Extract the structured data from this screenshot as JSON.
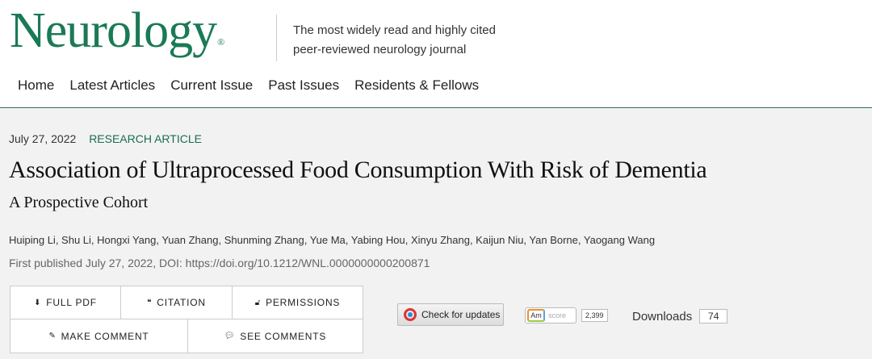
{
  "brand": {
    "name": "Neurology",
    "reg": "®",
    "tagline_line1": "The most widely read and highly cited",
    "tagline_line2": "peer-reviewed neurology journal"
  },
  "nav": {
    "items": [
      "Home",
      "Latest Articles",
      "Current Issue",
      "Past Issues",
      "Residents & Fellows"
    ]
  },
  "article": {
    "date": "July 27, 2022",
    "type": "RESEARCH ARTICLE",
    "title": "Association of Ultraprocessed Food Consumption With Risk of Dementia",
    "subtitle": "A Prospective Cohort",
    "authors": "Huiping Li, Shu Li, Hongxi Yang, Yuan Zhang, Shunming Zhang, Yue Ma, Yabing Hou, Xinyu Zhang, Kaijun Niu, Yan Borne, Yaogang Wang",
    "published": "First published July 27, 2022, DOI: https://doi.org/10.1212/WNL.0000000000200871"
  },
  "actions": {
    "full_pdf": "FULL PDF",
    "citation": "CITATION",
    "permissions": "PERMISSIONS",
    "make_comment": "MAKE COMMENT",
    "see_comments": "SEE COMMENTS"
  },
  "check_updates": "Check for updates",
  "altmetric": {
    "am": "Am",
    "label": "score",
    "value": "2,399"
  },
  "downloads": {
    "label": "Downloads",
    "count": "74"
  },
  "colors": {
    "brand_green": "#1a7a55",
    "type_green": "#1a6e4f",
    "background": "#f2f2f2"
  }
}
